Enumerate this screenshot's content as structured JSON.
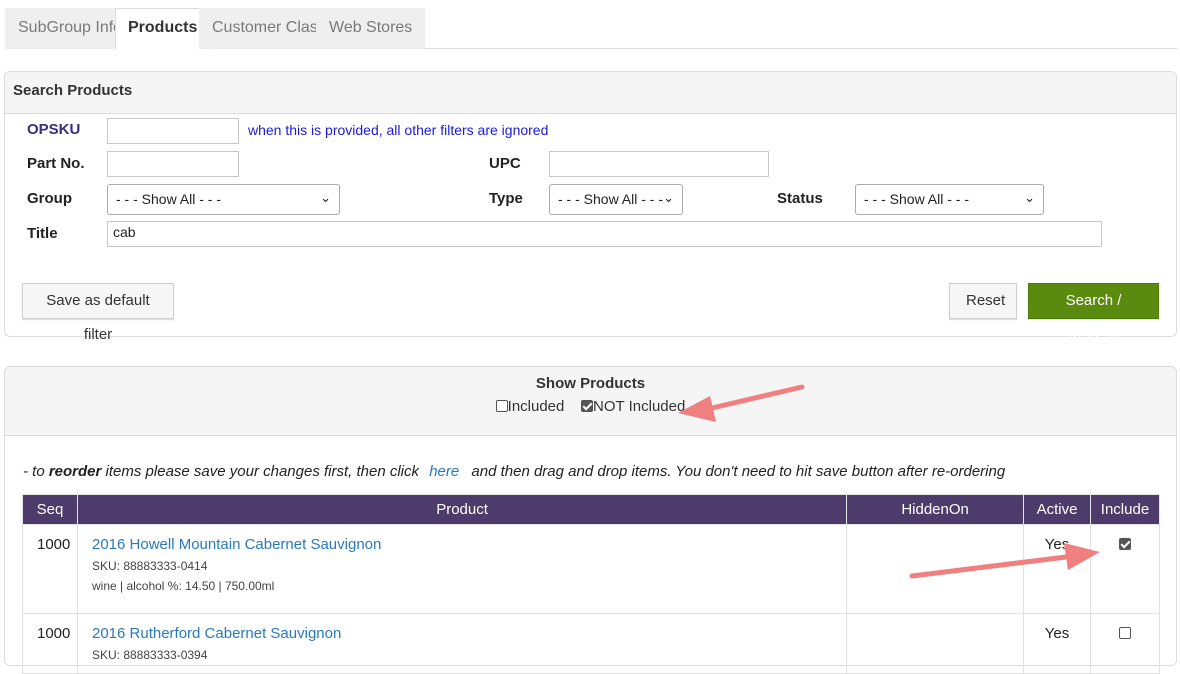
{
  "tabs": [
    "SubGroup Info",
    "Products",
    "Customer Class",
    "Web Stores"
  ],
  "search": {
    "heading": "Search Products",
    "opsku_label": "OPSKU",
    "opsku_value": "",
    "opsku_hint": "when this is provided, all other filters are ignored",
    "partno_label": "Part No.",
    "partno_value": "",
    "upc_label": "UPC",
    "upc_value": "",
    "group_label": "Group",
    "group_value": "- - - Show All - - -",
    "type_label": "Type",
    "type_value": "- - - Show All - - -",
    "status_label": "Status",
    "status_value": "- - - Show All - - -",
    "title_label": "Title",
    "title_value": "cab",
    "save_default_label": "Save as default filter",
    "reset_label": "Reset",
    "search_refresh_label": "Search / Refresh"
  },
  "show_products": {
    "title": "Show Products",
    "included_label": "Included",
    "included_checked": false,
    "not_included_label": "NOT Included",
    "not_included_checked": true
  },
  "reorder_note": {
    "prefix": "- to ",
    "bold": "reorder",
    "middle": " items please save your changes first, then click",
    "link": "here",
    "suffix": "and then drag and drop items. You don't need to hit save button after re-ordering"
  },
  "table": {
    "headers": [
      "Seq",
      "Product",
      "HiddenOn",
      "Active",
      "Include"
    ],
    "rows": [
      {
        "seq": "1000",
        "product": "2016 Howell Mountain Cabernet Sauvignon",
        "sku": "SKU: 88883333-0414",
        "details": "wine | alcohol %: 14.50 | 750.00ml",
        "hidden_on": "",
        "active": "Yes",
        "include": true
      },
      {
        "seq": "1000",
        "product": "2016 Rutherford Cabernet Sauvignon",
        "sku": "SKU: 88883333-0394",
        "details": "",
        "hidden_on": "",
        "active": "Yes",
        "include": false
      }
    ]
  },
  "colors": {
    "header_bg": "#4d3c6b",
    "accent_green": "#5a8a0e",
    "link_blue": "#2a7ab7",
    "arrow": "#f08080"
  }
}
